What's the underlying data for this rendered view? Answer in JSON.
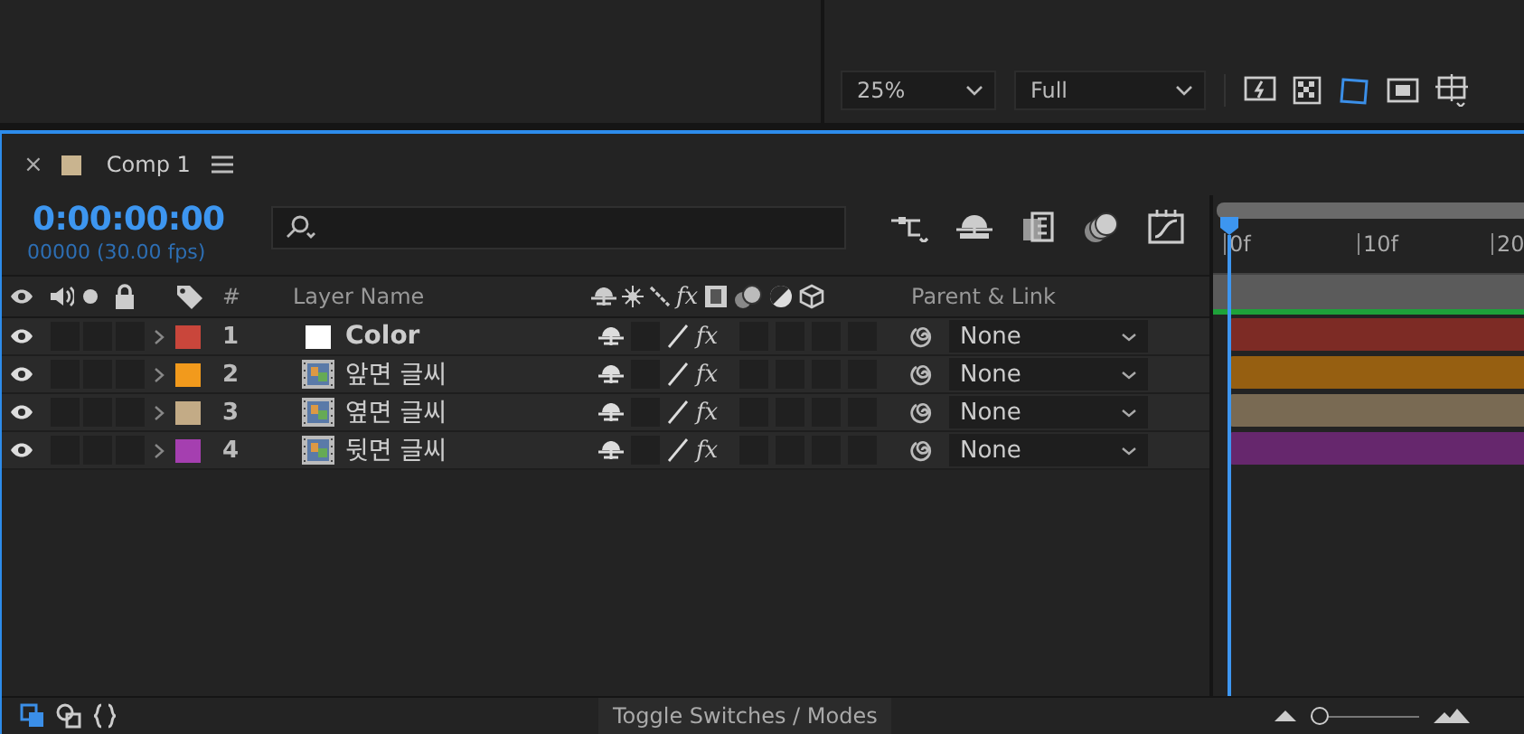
{
  "viewer": {
    "zoom": "25%",
    "resolution": "Full"
  },
  "comp_tab": {
    "close": "×",
    "title": "Comp 1"
  },
  "timecode": "0:00:00:00",
  "frame_info": "00000 (30.00 fps)",
  "columns": {
    "number": "#",
    "layer_name": "Layer Name",
    "effects": "fx",
    "parent": "Parent & Link"
  },
  "layers": [
    {
      "number": "1",
      "name": "Color",
      "kind": "solid",
      "color": "#c9463b",
      "visible": true,
      "effects": "fx",
      "parent": "None"
    },
    {
      "number": "2",
      "name": "앞면 글씨",
      "kind": "footage",
      "color": "#f29a1c",
      "visible": true,
      "effects": "fx",
      "parent": "None"
    },
    {
      "number": "3",
      "name": "옆면 글씨",
      "kind": "footage",
      "color": "#c3ab86",
      "visible": true,
      "effects": "fx",
      "parent": "None"
    },
    {
      "number": "4",
      "name": "뒷면 글씨",
      "kind": "footage",
      "color": "#a53fb0",
      "visible": true,
      "effects": "fx",
      "parent": "None"
    }
  ],
  "ruler": [
    "0f",
    "10f",
    "20"
  ],
  "status_bar": {
    "toggle": "Toggle Switches / Modes",
    "zoom": {
      "level": 0
    }
  }
}
